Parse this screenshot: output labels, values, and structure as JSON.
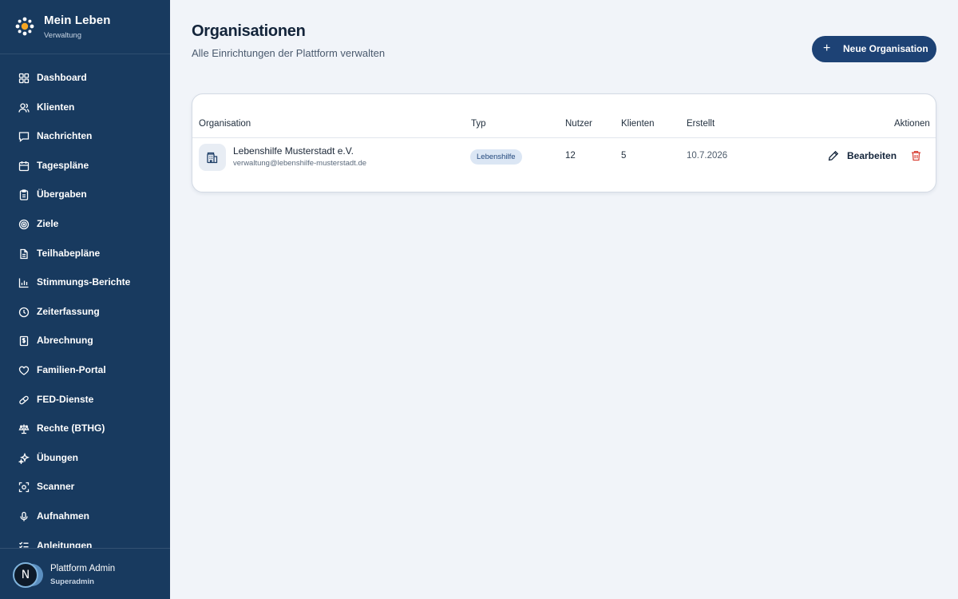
{
  "brand": {
    "title": "Mein Leben",
    "subtitle": "Verwaltung",
    "logo_icon": "flower-dots-icon",
    "logo_color_center": "#f5a623",
    "logo_color_petals": "#ffffff"
  },
  "sidebar": {
    "items": [
      {
        "label": "Dashboard",
        "icon": "grid-icon"
      },
      {
        "label": "Klienten",
        "icon": "users-icon"
      },
      {
        "label": "Nachrichten",
        "icon": "message-icon"
      },
      {
        "label": "Tagespläne",
        "icon": "calendar-icon"
      },
      {
        "label": "Übergaben",
        "icon": "clipboard-icon"
      },
      {
        "label": "Ziele",
        "icon": "target-icon"
      },
      {
        "label": "Teilhabepläne",
        "icon": "document-icon"
      },
      {
        "label": "Stimmungs-Berichte",
        "icon": "bar-chart-icon"
      },
      {
        "label": "Zeiterfassung",
        "icon": "clock-icon"
      },
      {
        "label": "Abrechnung",
        "icon": "receipt-icon"
      },
      {
        "label": "Familien-Portal",
        "icon": "heart-icon"
      },
      {
        "label": "FED-Dienste",
        "icon": "pill-icon"
      },
      {
        "label": "Rechte (BTHG)",
        "icon": "scale-icon"
      },
      {
        "label": "Übungen",
        "icon": "sparkle-icon"
      },
      {
        "label": "Scanner",
        "icon": "scan-icon"
      },
      {
        "label": "Aufnahmen",
        "icon": "microphone-icon"
      },
      {
        "label": "Anleitungen",
        "icon": "list-check-icon"
      }
    ]
  },
  "user": {
    "initial": "N",
    "name": "Plattform Admin",
    "role": "Superadmin"
  },
  "header": {
    "title": "Organisationen",
    "subtitle": "Alle Einrichtungen der Plattform verwalten",
    "new_button_label": "Neue Organisation",
    "new_button_icon": "plus-icon"
  },
  "table": {
    "columns": {
      "organisation": "Organisation",
      "typ": "Typ",
      "nutzer": "Nutzer",
      "klienten": "Klienten",
      "erstellt": "Erstellt",
      "aktionen": "Aktionen"
    },
    "rows": [
      {
        "name": "Lebenshilfe Musterstadt e.V.",
        "email": "verwaltung@lebenshilfe-musterstadt.de",
        "icon": "building-icon",
        "typ": "Lebenshilfe",
        "nutzer": "12",
        "klienten": "5",
        "erstellt": "10.7.2026",
        "edit_label": "Bearbeiten",
        "edit_icon": "pencil-icon",
        "delete_icon": "trash-icon"
      }
    ]
  },
  "colors": {
    "sidebar_bg": "#183a5f",
    "page_bg": "#f1f4f9",
    "primary_button": "#1d4275",
    "badge_bg": "#dbe6f4",
    "badge_text": "#24497d",
    "delete_red": "#d9463b"
  }
}
